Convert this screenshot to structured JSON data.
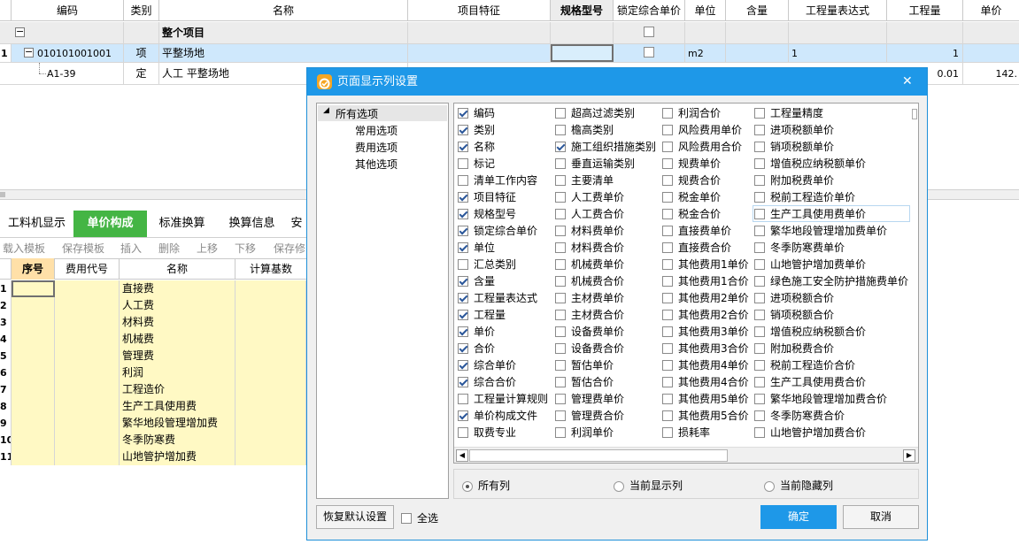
{
  "grid": {
    "headers": [
      "编码",
      "类别",
      "名称",
      "项目特征",
      "规格型号",
      "锁定综合单价",
      "单位",
      "含量",
      "工程量表达式",
      "工程量",
      "单价"
    ],
    "row0": {
      "name": "整个项目"
    },
    "row1": {
      "num": "1",
      "code": "010101001001",
      "type": "项",
      "name": "平整场地",
      "unit": "m2",
      "expr": "1",
      "qty": "1"
    },
    "row2": {
      "code": "A1-39",
      "type": "定",
      "name": "人工 平整场地",
      "qty": "0.01",
      "price": "142."
    }
  },
  "tabs": [
    "工料机显示",
    "单价构成",
    "标准换算",
    "换算信息",
    "安"
  ],
  "toolbar": [
    "载入模板",
    "保存模板",
    "插入",
    "删除",
    "上移",
    "下移",
    "保存修"
  ],
  "sub_grid": {
    "headers": [
      "序号",
      "费用代号",
      "名称",
      "计算基数"
    ],
    "rows": [
      {
        "num": "1",
        "name": "直接费"
      },
      {
        "num": "2",
        "name": "人工费"
      },
      {
        "num": "3",
        "name": "材料费"
      },
      {
        "num": "4",
        "name": "机械费"
      },
      {
        "num": "5",
        "name": "管理费"
      },
      {
        "num": "6",
        "name": "利润"
      },
      {
        "num": "7",
        "name": "工程造价"
      },
      {
        "num": "8",
        "name": "生产工具使用费"
      },
      {
        "num": "9",
        "name": "繁华地段管理增加费"
      },
      {
        "num": "10",
        "name": "冬季防寒费"
      },
      {
        "num": "11",
        "name": "山地管护增加费"
      }
    ]
  },
  "dialog": {
    "title": "页面显示列设置",
    "close": "✕",
    "tree": {
      "root": "所有选项",
      "children": [
        "常用选项",
        "费用选项",
        "其他选项"
      ]
    },
    "columns": [
      [
        {
          "label": "编码",
          "checked": true
        },
        {
          "label": "类别",
          "checked": true
        },
        {
          "label": "名称",
          "checked": true
        },
        {
          "label": "标记",
          "checked": false
        },
        {
          "label": "清单工作内容",
          "checked": false
        },
        {
          "label": "项目特征",
          "checked": true
        },
        {
          "label": "规格型号",
          "checked": true
        },
        {
          "label": "锁定综合单价",
          "checked": true
        },
        {
          "label": "单位",
          "checked": true
        },
        {
          "label": "汇总类别",
          "checked": false
        },
        {
          "label": "含量",
          "checked": true
        },
        {
          "label": "工程量表达式",
          "checked": true
        },
        {
          "label": "工程量",
          "checked": true
        },
        {
          "label": "单价",
          "checked": true
        },
        {
          "label": "合价",
          "checked": true
        },
        {
          "label": "综合单价",
          "checked": true
        },
        {
          "label": "综合合价",
          "checked": true
        },
        {
          "label": "工程量计算规则",
          "checked": false
        },
        {
          "label": "单价构成文件",
          "checked": true
        },
        {
          "label": "取费专业",
          "checked": false
        }
      ],
      [
        {
          "label": "超高过滤类别",
          "checked": false
        },
        {
          "label": "檐高类别",
          "checked": false
        },
        {
          "label": "施工组织措施类别",
          "checked": true
        },
        {
          "label": "垂直运输类别",
          "checked": false
        },
        {
          "label": "主要清单",
          "checked": false
        },
        {
          "label": "人工费单价",
          "checked": false
        },
        {
          "label": "人工费合价",
          "checked": false
        },
        {
          "label": "材料费单价",
          "checked": false
        },
        {
          "label": "材料费合价",
          "checked": false
        },
        {
          "label": "机械费单价",
          "checked": false
        },
        {
          "label": "机械费合价",
          "checked": false
        },
        {
          "label": "主材费单价",
          "checked": false
        },
        {
          "label": "主材费合价",
          "checked": false
        },
        {
          "label": "设备费单价",
          "checked": false
        },
        {
          "label": "设备费合价",
          "checked": false
        },
        {
          "label": "暂估单价",
          "checked": false
        },
        {
          "label": "暂估合价",
          "checked": false
        },
        {
          "label": "管理费单价",
          "checked": false
        },
        {
          "label": "管理费合价",
          "checked": false
        },
        {
          "label": "利润单价",
          "checked": false
        }
      ],
      [
        {
          "label": "利润合价",
          "checked": false
        },
        {
          "label": "风险费用单价",
          "checked": false
        },
        {
          "label": "风险费用合价",
          "checked": false
        },
        {
          "label": "规费单价",
          "checked": false
        },
        {
          "label": "规费合价",
          "checked": false
        },
        {
          "label": "税金单价",
          "checked": false
        },
        {
          "label": "税金合价",
          "checked": false
        },
        {
          "label": "直接费单价",
          "checked": false
        },
        {
          "label": "直接费合价",
          "checked": false
        },
        {
          "label": "其他费用1单价",
          "checked": false
        },
        {
          "label": "其他费用1合价",
          "checked": false
        },
        {
          "label": "其他费用2单价",
          "checked": false
        },
        {
          "label": "其他费用2合价",
          "checked": false
        },
        {
          "label": "其他费用3单价",
          "checked": false
        },
        {
          "label": "其他费用3合价",
          "checked": false
        },
        {
          "label": "其他费用4单价",
          "checked": false
        },
        {
          "label": "其他费用4合价",
          "checked": false
        },
        {
          "label": "其他费用5单价",
          "checked": false
        },
        {
          "label": "其他费用5合价",
          "checked": false
        },
        {
          "label": "损耗率",
          "checked": false
        }
      ],
      [
        {
          "label": "工程量精度",
          "checked": false
        },
        {
          "label": "进项税额单价",
          "checked": false
        },
        {
          "label": "销项税额单价",
          "checked": false
        },
        {
          "label": "增值税应纳税额单价",
          "checked": false
        },
        {
          "label": "附加税费单价",
          "checked": false
        },
        {
          "label": "税前工程造价单价",
          "checked": false
        },
        {
          "label": "生产工具使用费单价",
          "checked": false
        },
        {
          "label": "繁华地段管理增加费单价",
          "checked": false
        },
        {
          "label": "冬季防寒费单价",
          "checked": false
        },
        {
          "label": "山地管护增加费单价",
          "checked": false
        },
        {
          "label": "绿色施工安全防护措施费单价",
          "checked": false
        },
        {
          "label": "进项税额合价",
          "checked": false
        },
        {
          "label": "销项税额合价",
          "checked": false
        },
        {
          "label": "增值税应纳税额合价",
          "checked": false
        },
        {
          "label": "附加税费合价",
          "checked": false
        },
        {
          "label": "税前工程造价合价",
          "checked": false
        },
        {
          "label": "生产工具使用费合价",
          "checked": false
        },
        {
          "label": "繁华地段管理增加费合价",
          "checked": false
        },
        {
          "label": "冬季防寒费合价",
          "checked": false
        },
        {
          "label": "山地管护增加费合价",
          "checked": false
        }
      ]
    ],
    "radios": [
      {
        "label": "所有列",
        "checked": true
      },
      {
        "label": "当前显示列",
        "checked": false
      },
      {
        "label": "当前隐藏列",
        "checked": false
      }
    ],
    "restore_label": "恢复默认设置",
    "select_all_label": "全选",
    "ok_label": "确定",
    "cancel_label": "取消"
  },
  "colors": {
    "accent": "#1e98e8",
    "yellow_cell": "#fff9c4",
    "selected_row": "#cfe8fc",
    "active_tab": "#44b544"
  }
}
